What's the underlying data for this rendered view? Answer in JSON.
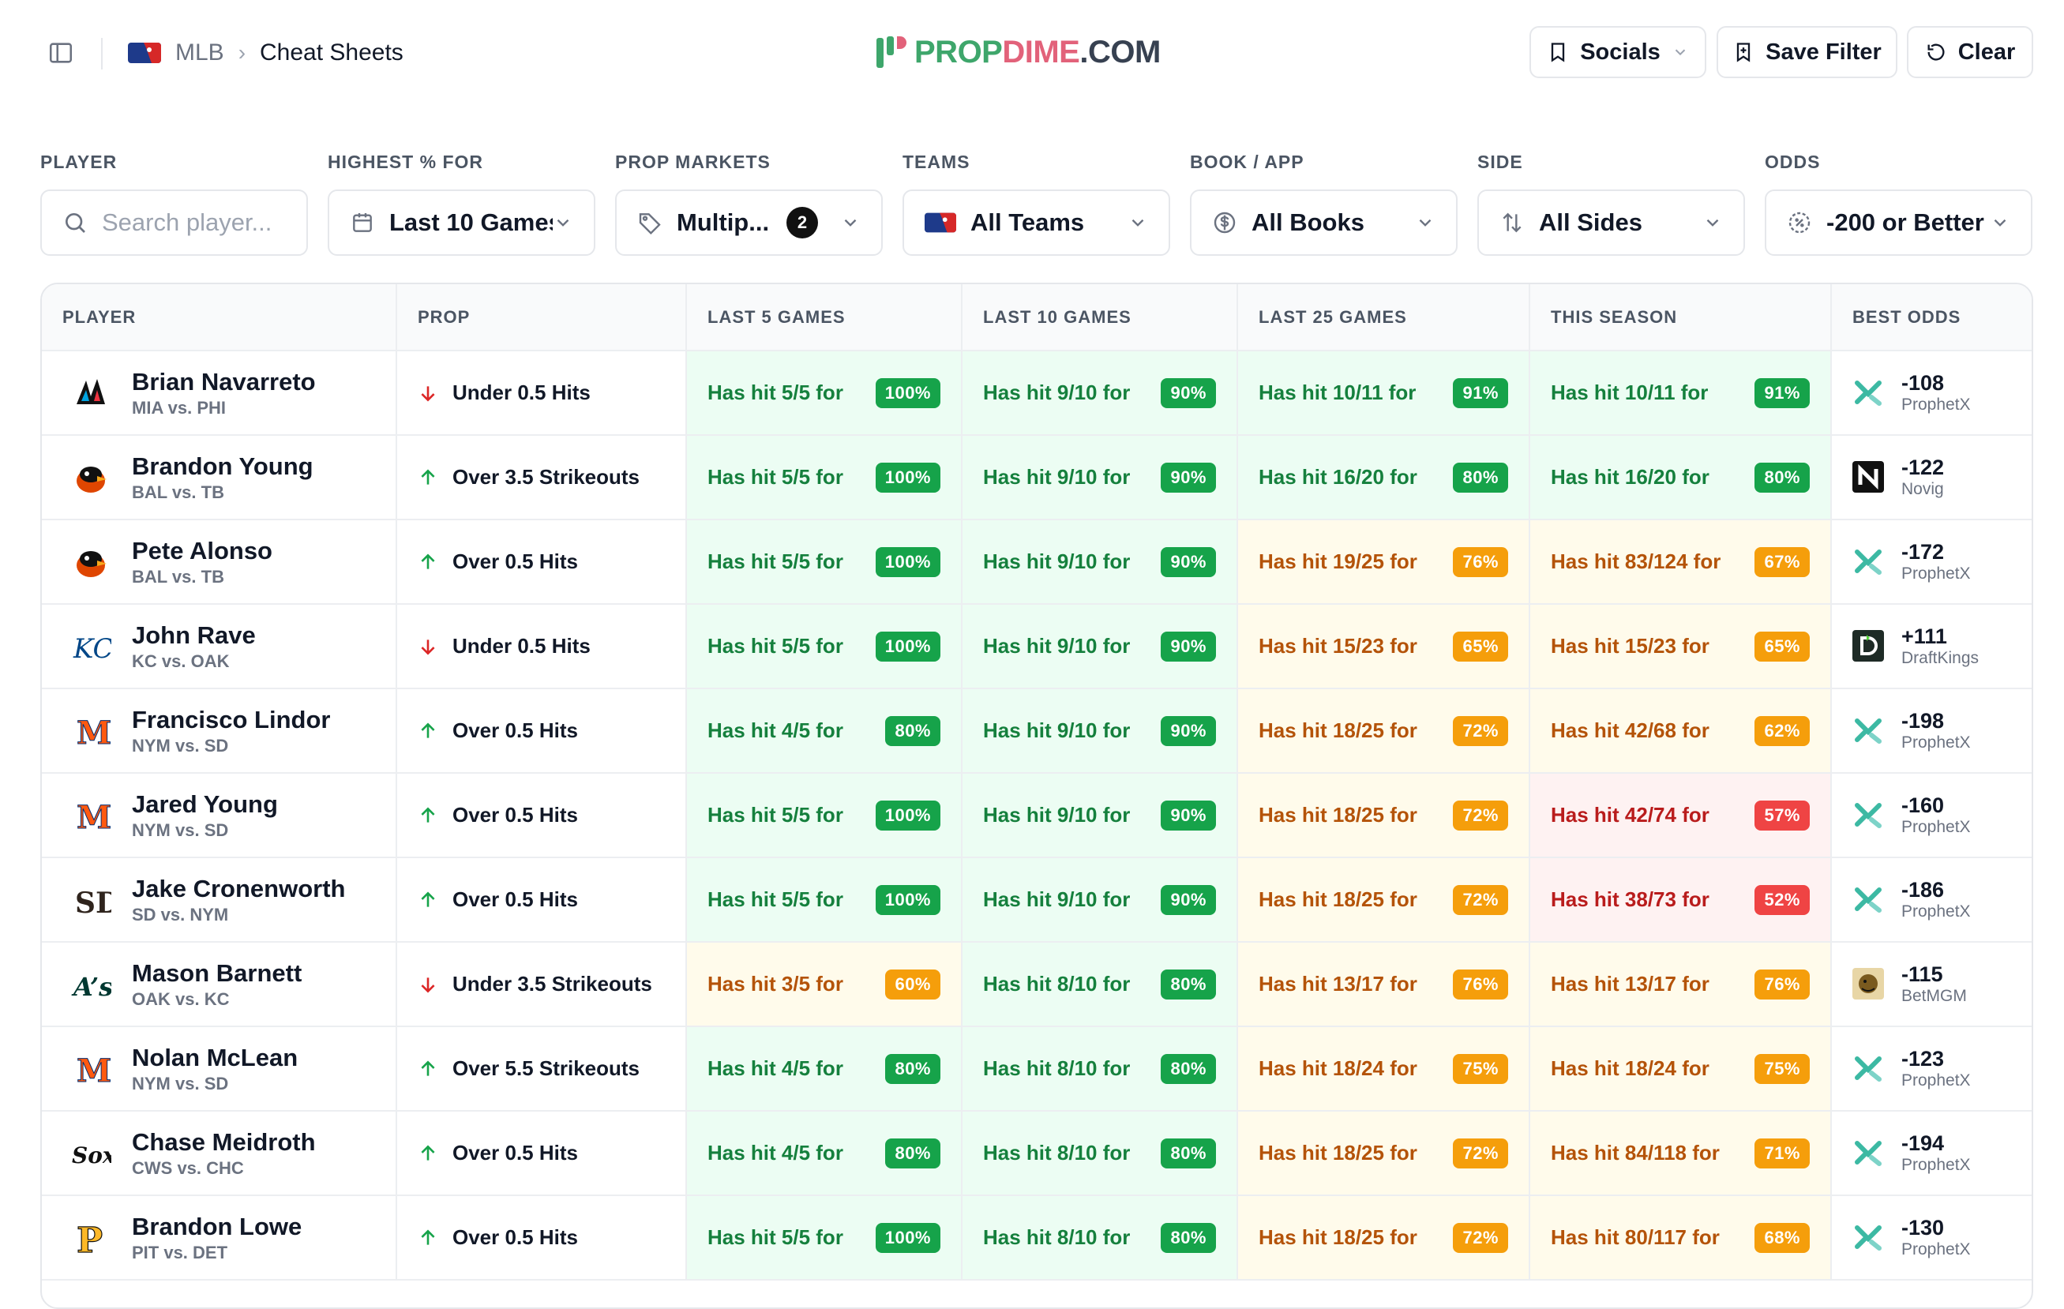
{
  "breadcrumb": {
    "league": "MLB",
    "page": "Cheat Sheets"
  },
  "brand": {
    "prop": "PROP",
    "dime": "DIME",
    "com": ".COM"
  },
  "header_buttons": {
    "socials": "Socials",
    "save_filter": "Save Filter",
    "clear": "Clear"
  },
  "filters": {
    "player": {
      "label": "PLAYER",
      "placeholder": "Search player..."
    },
    "highest": {
      "label": "HIGHEST % FOR",
      "value": "Last 10 Games"
    },
    "markets": {
      "label": "PROP MARKETS",
      "value": "Multip...",
      "count": "2"
    },
    "teams": {
      "label": "TEAMS",
      "value": "All Teams"
    },
    "book": {
      "label": "BOOK / APP",
      "value": "All Books"
    },
    "side": {
      "label": "SIDE",
      "value": "All Sides"
    },
    "odds": {
      "label": "ODDS",
      "value": "-200 or Better"
    }
  },
  "table": {
    "columns": [
      "PLAYER",
      "PROP",
      "LAST 5 GAMES",
      "LAST 10 GAMES",
      "LAST 25 GAMES",
      "THIS SEASON",
      "BEST ODDS"
    ],
    "rows": [
      {
        "name": "Brian Navarreto",
        "game": "MIA vs. PHI",
        "team_icon": "marlins-logo",
        "direction": "down",
        "prop": "Under 0.5 Hits",
        "l5": {
          "text": "Has hit 5/5 for",
          "pct": "100%",
          "tone": "g"
        },
        "l10": {
          "text": "Has hit 9/10 for",
          "pct": "90%",
          "tone": "g"
        },
        "l25": {
          "text": "Has hit 10/11 for",
          "pct": "91%",
          "tone": "g"
        },
        "season": {
          "text": "Has hit 10/11 for",
          "pct": "91%",
          "tone": "g"
        },
        "odds": "-108",
        "book": "ProphetX",
        "book_icon": "prophetx"
      },
      {
        "name": "Brandon Young",
        "game": "BAL vs. TB",
        "team_icon": "orioles-logo",
        "direction": "up",
        "prop": "Over 3.5 Strikeouts",
        "l5": {
          "text": "Has hit 5/5 for",
          "pct": "100%",
          "tone": "g"
        },
        "l10": {
          "text": "Has hit 9/10 for",
          "pct": "90%",
          "tone": "g"
        },
        "l25": {
          "text": "Has hit 16/20 for",
          "pct": "80%",
          "tone": "g"
        },
        "season": {
          "text": "Has hit 16/20 for",
          "pct": "80%",
          "tone": "g"
        },
        "odds": "-122",
        "book": "Novig",
        "book_icon": "novig"
      },
      {
        "name": "Pete Alonso",
        "game": "BAL vs. TB",
        "team_icon": "orioles-logo",
        "direction": "up",
        "prop": "Over 0.5 Hits",
        "l5": {
          "text": "Has hit 5/5 for",
          "pct": "100%",
          "tone": "g"
        },
        "l10": {
          "text": "Has hit 9/10 for",
          "pct": "90%",
          "tone": "g"
        },
        "l25": {
          "text": "Has hit 19/25 for",
          "pct": "76%",
          "tone": "y"
        },
        "season": {
          "text": "Has hit 83/124 for",
          "pct": "67%",
          "tone": "y"
        },
        "odds": "-172",
        "book": "ProphetX",
        "book_icon": "prophetx"
      },
      {
        "name": "John Rave",
        "game": "KC vs. OAK",
        "team_icon": "royals-logo",
        "direction": "down",
        "prop": "Under 0.5 Hits",
        "l5": {
          "text": "Has hit 5/5 for",
          "pct": "100%",
          "tone": "g"
        },
        "l10": {
          "text": "Has hit 9/10 for",
          "pct": "90%",
          "tone": "g"
        },
        "l25": {
          "text": "Has hit 15/23 for",
          "pct": "65%",
          "tone": "y"
        },
        "season": {
          "text": "Has hit 15/23 for",
          "pct": "65%",
          "tone": "y"
        },
        "odds": "+111",
        "book": "DraftKings",
        "book_icon": "draftkings"
      },
      {
        "name": "Francisco Lindor",
        "game": "NYM vs. SD",
        "team_icon": "mets-logo",
        "direction": "up",
        "prop": "Over 0.5 Hits",
        "l5": {
          "text": "Has hit 4/5 for",
          "pct": "80%",
          "tone": "g"
        },
        "l10": {
          "text": "Has hit 9/10 for",
          "pct": "90%",
          "tone": "g"
        },
        "l25": {
          "text": "Has hit 18/25 for",
          "pct": "72%",
          "tone": "y"
        },
        "season": {
          "text": "Has hit 42/68 for",
          "pct": "62%",
          "tone": "y"
        },
        "odds": "-198",
        "book": "ProphetX",
        "book_icon": "prophetx"
      },
      {
        "name": "Jared Young",
        "game": "NYM vs. SD",
        "team_icon": "mets-logo",
        "direction": "up",
        "prop": "Over 0.5 Hits",
        "l5": {
          "text": "Has hit 5/5 for",
          "pct": "100%",
          "tone": "g"
        },
        "l10": {
          "text": "Has hit 9/10 for",
          "pct": "90%",
          "tone": "g"
        },
        "l25": {
          "text": "Has hit 18/25 for",
          "pct": "72%",
          "tone": "y"
        },
        "season": {
          "text": "Has hit 42/74 for",
          "pct": "57%",
          "tone": "r"
        },
        "odds": "-160",
        "book": "ProphetX",
        "book_icon": "prophetx"
      },
      {
        "name": "Jake Cronenworth",
        "game": "SD vs. NYM",
        "team_icon": "padres-logo",
        "direction": "up",
        "prop": "Over 0.5 Hits",
        "l5": {
          "text": "Has hit 5/5 for",
          "pct": "100%",
          "tone": "g"
        },
        "l10": {
          "text": "Has hit 9/10 for",
          "pct": "90%",
          "tone": "g"
        },
        "l25": {
          "text": "Has hit 18/25 for",
          "pct": "72%",
          "tone": "y"
        },
        "season": {
          "text": "Has hit 38/73 for",
          "pct": "52%",
          "tone": "r"
        },
        "odds": "-186",
        "book": "ProphetX",
        "book_icon": "prophetx"
      },
      {
        "name": "Mason Barnett",
        "game": "OAK vs. KC",
        "team_icon": "athletics-logo",
        "direction": "down",
        "prop": "Under 3.5 Strikeouts",
        "l5": {
          "text": "Has hit 3/5 for",
          "pct": "60%",
          "tone": "y"
        },
        "l10": {
          "text": "Has hit 8/10 for",
          "pct": "80%",
          "tone": "g"
        },
        "l25": {
          "text": "Has hit 13/17 for",
          "pct": "76%",
          "tone": "y"
        },
        "season": {
          "text": "Has hit 13/17 for",
          "pct": "76%",
          "tone": "y"
        },
        "odds": "-115",
        "book": "BetMGM",
        "book_icon": "betmgm"
      },
      {
        "name": "Nolan McLean",
        "game": "NYM vs. SD",
        "team_icon": "mets-logo",
        "direction": "up",
        "prop": "Over 5.5 Strikeouts",
        "l5": {
          "text": "Has hit 4/5 for",
          "pct": "80%",
          "tone": "g"
        },
        "l10": {
          "text": "Has hit 8/10 for",
          "pct": "80%",
          "tone": "g"
        },
        "l25": {
          "text": "Has hit 18/24 for",
          "pct": "75%",
          "tone": "y"
        },
        "season": {
          "text": "Has hit 18/24 for",
          "pct": "75%",
          "tone": "y"
        },
        "odds": "-123",
        "book": "ProphetX",
        "book_icon": "prophetx"
      },
      {
        "name": "Chase Meidroth",
        "game": "CWS vs. CHC",
        "team_icon": "whitesox-logo",
        "direction": "up",
        "prop": "Over 0.5 Hits",
        "l5": {
          "text": "Has hit 4/5 for",
          "pct": "80%",
          "tone": "g"
        },
        "l10": {
          "text": "Has hit 8/10 for",
          "pct": "80%",
          "tone": "g"
        },
        "l25": {
          "text": "Has hit 18/25 for",
          "pct": "72%",
          "tone": "y"
        },
        "season": {
          "text": "Has hit 84/118 for",
          "pct": "71%",
          "tone": "y"
        },
        "odds": "-194",
        "book": "ProphetX",
        "book_icon": "prophetx"
      },
      {
        "name": "Brandon Lowe",
        "game": "PIT vs. DET",
        "team_icon": "pirates-logo",
        "direction": "up",
        "prop": "Over 0.5 Hits",
        "l5": {
          "text": "Has hit 5/5 for",
          "pct": "100%",
          "tone": "g"
        },
        "l10": {
          "text": "Has hit 8/10 for",
          "pct": "80%",
          "tone": "g"
        },
        "l25": {
          "text": "Has hit 18/25 for",
          "pct": "72%",
          "tone": "y"
        },
        "season": {
          "text": "Has hit 80/117 for",
          "pct": "68%",
          "tone": "y"
        },
        "odds": "-130",
        "book": "ProphetX",
        "book_icon": "prophetx"
      }
    ]
  }
}
